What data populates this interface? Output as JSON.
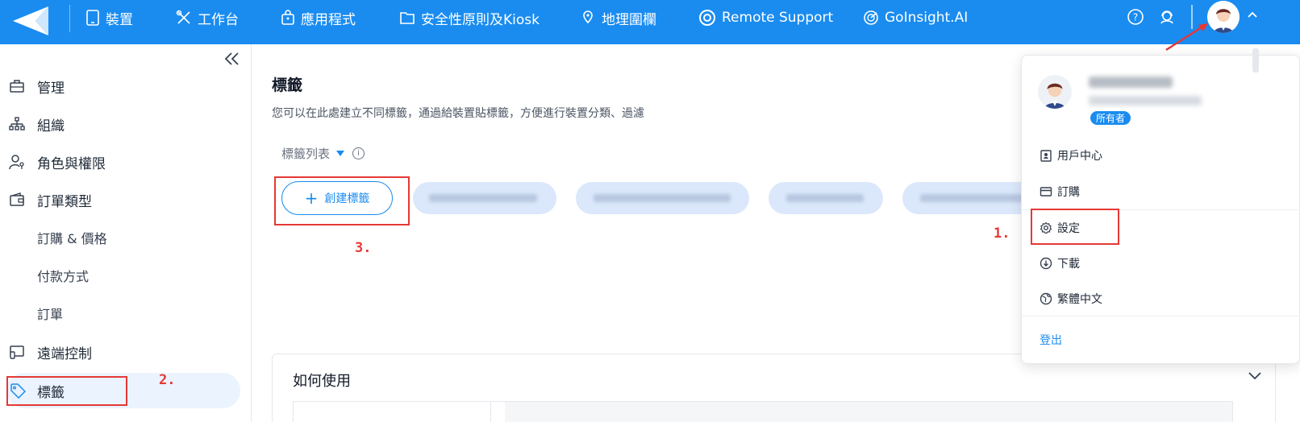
{
  "topbar": {
    "nav": [
      {
        "label": "裝置",
        "icon": "tablet-icon"
      },
      {
        "label": "工作台",
        "icon": "tools-icon"
      },
      {
        "label": "應用程式",
        "icon": "bag-icon"
      },
      {
        "label": "安全性原則及Kiosk",
        "icon": "folder-icon"
      },
      {
        "label": "地理圍欄",
        "icon": "map-pin-icon"
      },
      {
        "label": "Remote Support",
        "icon": "lifebuoy-icon"
      },
      {
        "label": "GoInsight.AI",
        "icon": "radar-icon"
      }
    ],
    "help_icon": "question-circle-icon",
    "support_icon": "headset-icon",
    "accent_color": "#1a8cf0"
  },
  "sidebar": {
    "items": [
      {
        "label": "管理",
        "icon": "briefcase-icon"
      },
      {
        "label": "組織",
        "icon": "org-tree-icon"
      },
      {
        "label": "角色與權限",
        "icon": "user-key-icon"
      },
      {
        "label": "訂單類型",
        "icon": "wallet-icon"
      },
      {
        "label": "訂購 & 價格"
      },
      {
        "label": "付款方式"
      },
      {
        "label": "訂單"
      },
      {
        "label": "遠端控制",
        "icon": "remote-screen-icon"
      },
      {
        "label": "標籤",
        "icon": "tag-icon"
      }
    ]
  },
  "main": {
    "title": "標籤",
    "description": "您可以在此處建立不同標籤，通過給裝置貼標籤，方便進行裝置分類、過濾",
    "tag_list_label": "標籤列表",
    "info": "i",
    "create_button": "創建標籤",
    "create_plus": "+",
    "howto_title": "如何使用"
  },
  "annotations": {
    "step1": "1.",
    "step2": "2.",
    "step3": "3.",
    "color": "#e53935"
  },
  "user_menu": {
    "role_badge": "所有者",
    "items": [
      {
        "label": "用戶中心",
        "icon": "id-badge-icon"
      },
      {
        "label": "訂購",
        "icon": "card-icon"
      },
      {
        "label": "設定",
        "icon": "gear-icon"
      },
      {
        "label": "下載",
        "icon": "download-circle-icon"
      },
      {
        "label": "繁體中文",
        "icon": "globe-icon"
      }
    ],
    "logout": "登出"
  }
}
